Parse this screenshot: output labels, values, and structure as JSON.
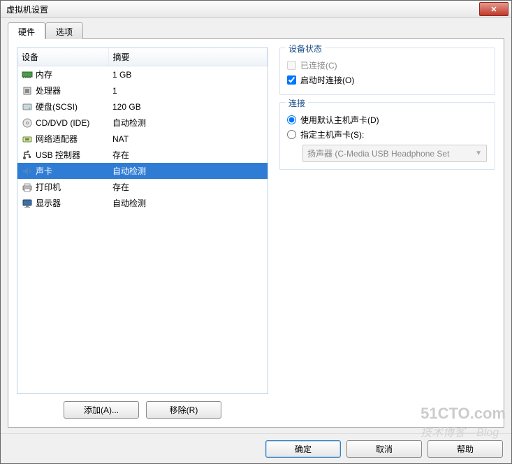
{
  "window": {
    "title": "虚拟机设置"
  },
  "tabs": {
    "hardware": "硬件",
    "options": "选项",
    "active": "hardware"
  },
  "hwlist": {
    "col_device": "设备",
    "col_summary": "摘要",
    "items": [
      {
        "icon": "memory",
        "name": "内存",
        "summary": "1 GB"
      },
      {
        "icon": "cpu",
        "name": "处理器",
        "summary": "1"
      },
      {
        "icon": "disk",
        "name": "硬盘(SCSI)",
        "summary": "120 GB"
      },
      {
        "icon": "cd",
        "name": "CD/DVD (IDE)",
        "summary": "自动检测"
      },
      {
        "icon": "net",
        "name": "网络适配器",
        "summary": "NAT"
      },
      {
        "icon": "usb",
        "name": "USB 控制器",
        "summary": "存在"
      },
      {
        "icon": "sound",
        "name": "声卡",
        "summary": "自动检测",
        "selected": true
      },
      {
        "icon": "printer",
        "name": "打印机",
        "summary": "存在"
      },
      {
        "icon": "display",
        "name": "显示器",
        "summary": "自动检测"
      }
    ]
  },
  "buttons": {
    "add": "添加(A)...",
    "remove": "移除(R)",
    "ok": "确定",
    "cancel": "取消",
    "help": "帮助"
  },
  "group_status": {
    "legend": "设备状态",
    "connected": {
      "label": "已连接(C)",
      "checked": false,
      "enabled": false
    },
    "connect_at_power": {
      "label": "启动时连接(O)",
      "checked": true
    }
  },
  "group_connect": {
    "legend": "连接",
    "use_default": {
      "label": "使用默认主机声卡(D)",
      "checked": true
    },
    "specify": {
      "label": "指定主机声卡(S):",
      "checked": false
    },
    "select_value": "扬声器 (C-Media USB Headphone Set"
  },
  "watermark": {
    "big": "51CTO.com",
    "small": "技术博客—Blog"
  }
}
